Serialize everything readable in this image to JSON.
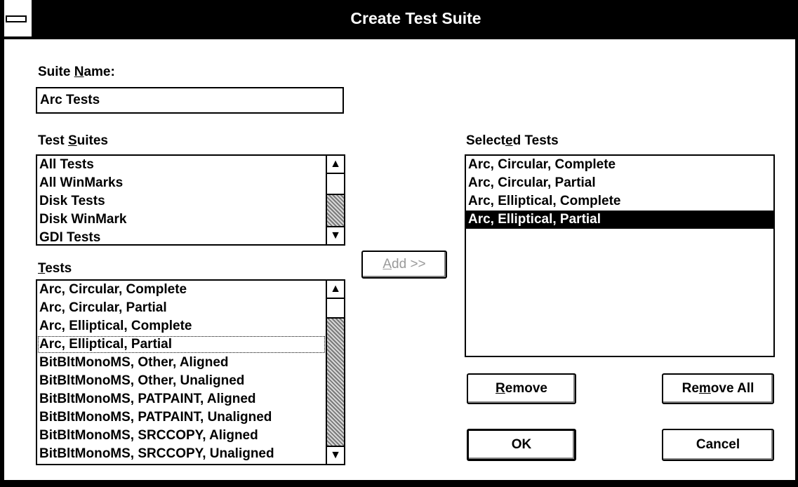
{
  "window": {
    "title": "Create Test Suite"
  },
  "suite_name": {
    "label_pre": "Suite ",
    "label_key": "N",
    "label_post": "ame:",
    "value": "Arc Tests"
  },
  "test_suites": {
    "label_pre": "Test ",
    "label_key": "S",
    "label_post": "uites",
    "items": [
      "All Tests",
      "All WinMarks",
      "Disk Tests",
      "Disk WinMark",
      "GDI Tests"
    ]
  },
  "tests": {
    "label_pre": "",
    "label_key": "T",
    "label_post": "ests",
    "items": [
      "Arc, Circular, Complete",
      "Arc, Circular, Partial",
      "Arc, Elliptical, Complete",
      "Arc, Elliptical, Partial",
      "BitBltMonoMS, Other, Aligned",
      "BitBltMonoMS, Other, Unaligned",
      "BitBltMonoMS, PATPAINT, Aligned",
      "BitBltMonoMS, PATPAINT, Unaligned",
      "BitBltMonoMS, SRCCOPY, Aligned",
      "BitBltMonoMS, SRCCOPY, Unaligned"
    ],
    "focused_index": 3
  },
  "add_button": {
    "label_pre": "",
    "label_key": "A",
    "label_post": "dd >>",
    "enabled": false
  },
  "selected_tests": {
    "label_pre": "Select",
    "label_key": "e",
    "label_post": "d Tests",
    "items": [
      "Arc, Circular, Complete",
      "Arc, Circular, Partial",
      "Arc, Elliptical, Complete",
      "Arc, Elliptical, Partial"
    ],
    "selected_index": 3
  },
  "buttons": {
    "remove": {
      "key": "R",
      "rest": "emove"
    },
    "remove_all": {
      "pre": "Re",
      "key": "m",
      "rest": "ove All"
    },
    "ok": "OK",
    "cancel": "Cancel"
  },
  "icons": {
    "scroll_up": "▲",
    "scroll_down": "▼"
  },
  "colors": {
    "title_bar": "#000000",
    "selection": "#000000",
    "disabled_text": "#9a9a9a"
  }
}
